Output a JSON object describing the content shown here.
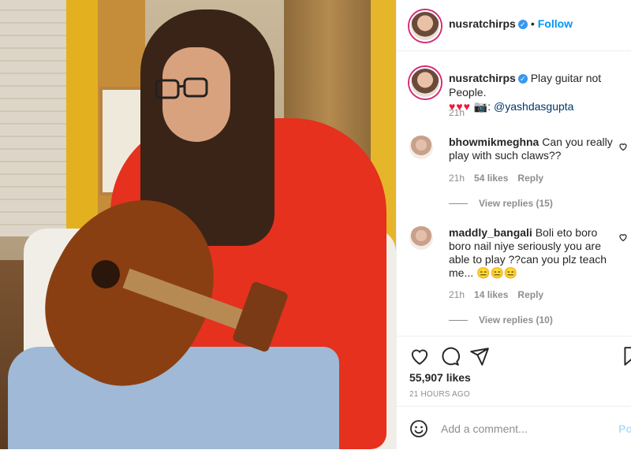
{
  "header": {
    "username": "nusratchirps",
    "dot": "•",
    "follow_label": "Follow"
  },
  "caption": {
    "username": "nusratchirps",
    "text": "Play guitar not People.",
    "hearts": "♥♥♥",
    "camera": "📷:",
    "mention": "@yashdasgupta",
    "time": "21h"
  },
  "comments": [
    {
      "username": "bhowmikmeghna",
      "text": "Can you really play with such claws??",
      "time": "21h",
      "likes": "54 likes",
      "reply_label": "Reply",
      "view_replies": "View replies (15)"
    },
    {
      "username": "maddly_bangali",
      "text": "Boli eto boro boro nail niye seriously you are able to play ??can you plz teach me...",
      "emoji": "😑😑😑",
      "time": "21h",
      "likes": "14 likes",
      "reply_label": "Reply",
      "view_replies": "View replies (10)"
    }
  ],
  "post": {
    "likes": "55,907 likes",
    "time_ago": "21 HOURS AGO"
  },
  "add_comment": {
    "placeholder": "Add a comment...",
    "post_label": "Post"
  },
  "icons": {
    "verified": "verified-badge",
    "like": "heart-outline",
    "comment": "speech-bubble",
    "share": "paper-plane",
    "save": "bookmark",
    "emoji": "smiley-face"
  },
  "colors": {
    "accent": "#0095f6",
    "verified": "#3897f0",
    "hearts": "#ed1a3b",
    "hoodie": "#e5311e"
  }
}
